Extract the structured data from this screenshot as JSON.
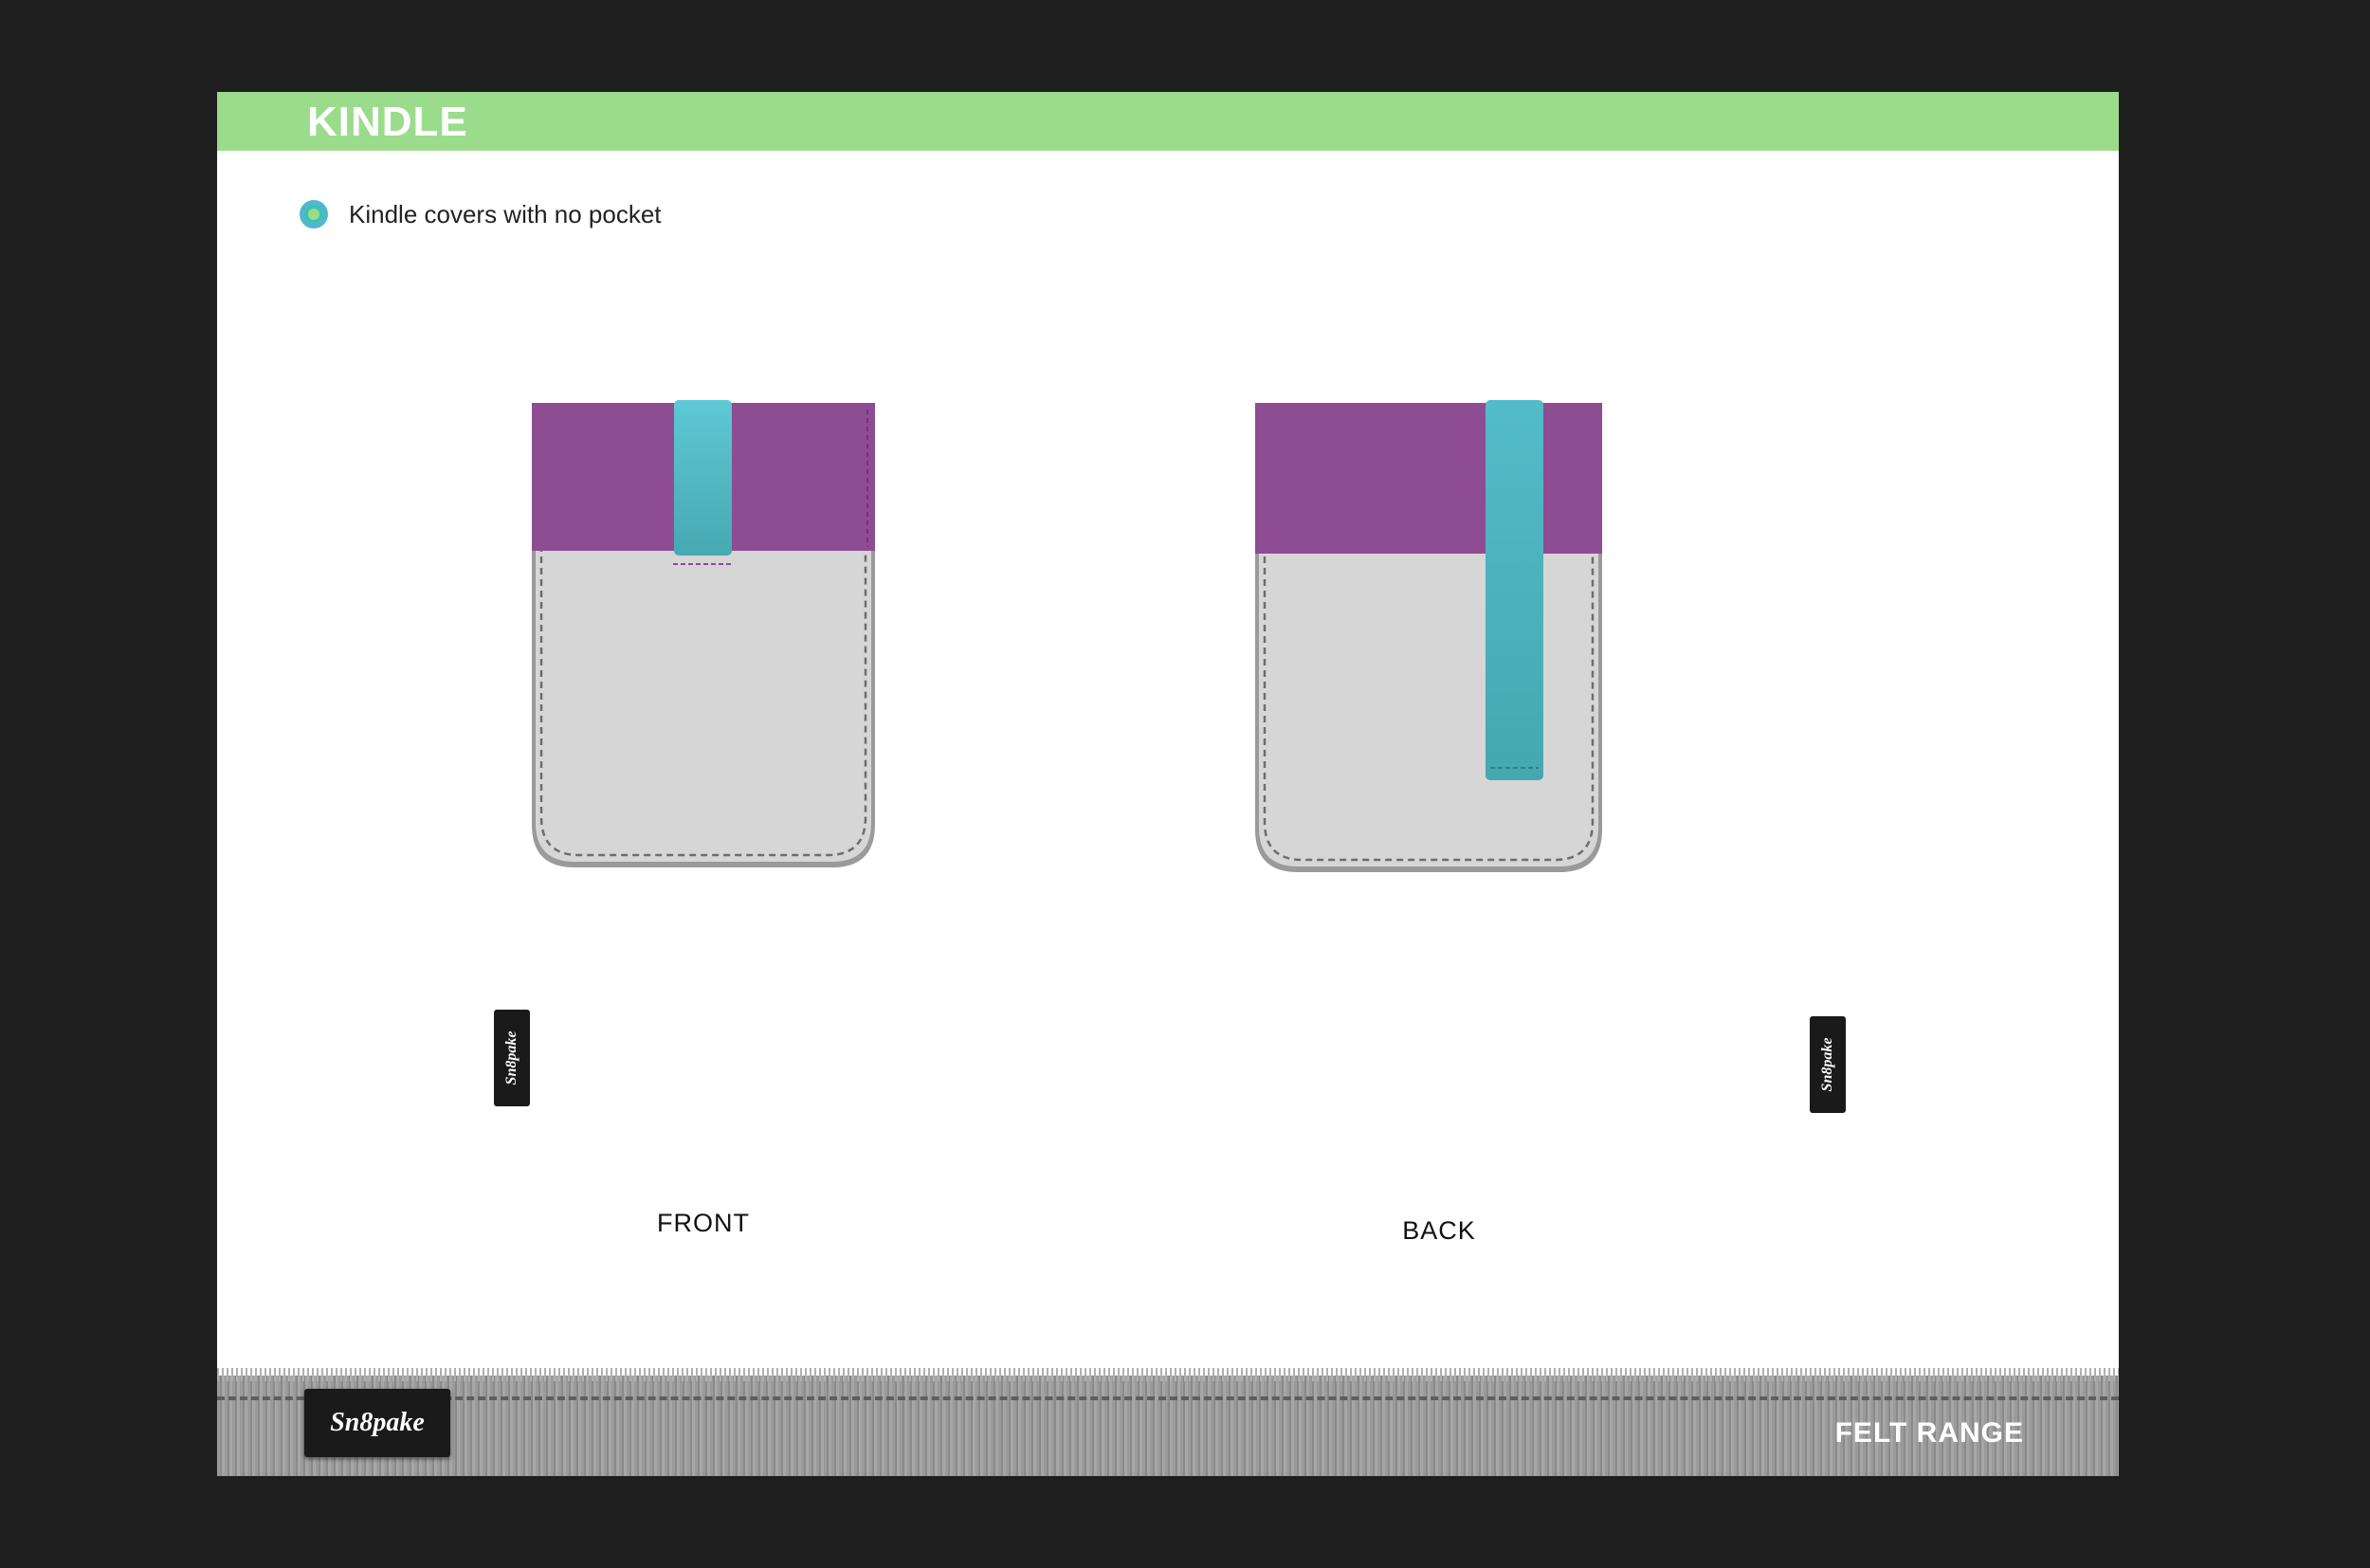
{
  "header": {
    "title": "KINDLE"
  },
  "bullet": {
    "text": "Kindle covers with no pocket"
  },
  "views": [
    {
      "caption": "FRONT",
      "tag_text": "Sn8pake"
    },
    {
      "caption": "BACK",
      "tag_text": "Sn8pake"
    }
  ],
  "footer": {
    "logo_text": "Sn8pake",
    "right_text": "FELT RANGE"
  },
  "colors": {
    "header_green": "#9bdc8c",
    "felt_purple": "#8e4c93",
    "strap_teal": "#4fb8c3",
    "felt_grey": "#d4d4d4",
    "rim_grey": "#9a9a9a"
  }
}
